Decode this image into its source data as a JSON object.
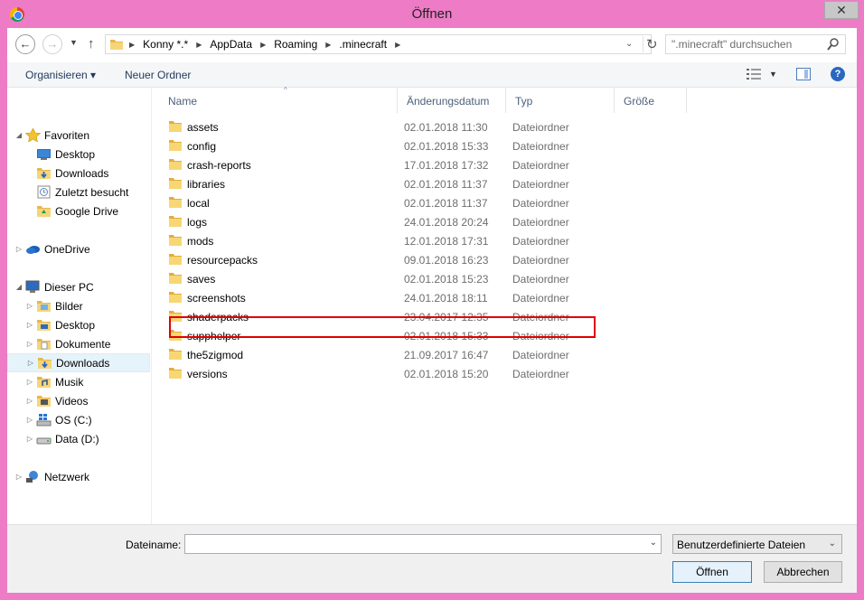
{
  "window": {
    "title": "Öffnen",
    "close_label": "✕"
  },
  "nav": {
    "breadcrumbs": [
      "Konny *.*",
      "AppData",
      "Roaming",
      ".minecraft"
    ],
    "search_placeholder": "\".minecraft\" durchsuchen"
  },
  "toolbar": {
    "organize_label": "Organisieren ▾",
    "new_folder_label": "Neuer Ordner"
  },
  "sidebar": {
    "items": [
      {
        "label": "Favoriten",
        "icon": "star-icon",
        "arrow": "◢"
      },
      {
        "label": "Desktop",
        "icon": "desktop-icon"
      },
      {
        "label": "Downloads",
        "icon": "downloads-folder-icon"
      },
      {
        "label": "Zuletzt besucht",
        "icon": "recent-places-icon"
      },
      {
        "label": "Google Drive",
        "icon": "google-drive-folder-icon"
      },
      {
        "label": "OneDrive",
        "icon": "onedrive-icon",
        "arrow": "▷"
      },
      {
        "label": "Dieser PC",
        "icon": "computer-icon",
        "arrow": "◢"
      },
      {
        "label": "Bilder",
        "icon": "pictures-folder-icon",
        "arrow": "▷"
      },
      {
        "label": "Desktop",
        "icon": "desktop-folder-icon",
        "arrow": "▷"
      },
      {
        "label": "Dokumente",
        "icon": "documents-folder-icon",
        "arrow": "▷"
      },
      {
        "label": "Downloads",
        "icon": "downloads-folder-icon",
        "arrow": "▷"
      },
      {
        "label": "Musik",
        "icon": "music-folder-icon",
        "arrow": "▷"
      },
      {
        "label": "Videos",
        "icon": "videos-folder-icon",
        "arrow": "▷"
      },
      {
        "label": "OS (C:)",
        "icon": "windows-drive-icon",
        "arrow": "▷"
      },
      {
        "label": "Data (D:)",
        "icon": "drive-icon",
        "arrow": "▷"
      },
      {
        "label": "Netzwerk",
        "icon": "network-icon",
        "arrow": "▷"
      }
    ]
  },
  "columns": {
    "name": "Name",
    "date": "Änderungsdatum",
    "type": "Typ",
    "size": "Größe"
  },
  "files": [
    {
      "name": "assets",
      "date": "02.01.2018 11:30",
      "type": "Dateiordner"
    },
    {
      "name": "config",
      "date": "02.01.2018 15:33",
      "type": "Dateiordner"
    },
    {
      "name": "crash-reports",
      "date": "17.01.2018 17:32",
      "type": "Dateiordner"
    },
    {
      "name": "libraries",
      "date": "02.01.2018 11:37",
      "type": "Dateiordner"
    },
    {
      "name": "local",
      "date": "02.01.2018 11:37",
      "type": "Dateiordner"
    },
    {
      "name": "logs",
      "date": "24.01.2018 20:24",
      "type": "Dateiordner"
    },
    {
      "name": "mods",
      "date": "12.01.2018 17:31",
      "type": "Dateiordner"
    },
    {
      "name": "resourcepacks",
      "date": "09.01.2018 16:23",
      "type": "Dateiordner"
    },
    {
      "name": "saves",
      "date": "02.01.2018 15:23",
      "type": "Dateiordner"
    },
    {
      "name": "screenshots",
      "date": "24.01.2018 18:11",
      "type": "Dateiordner"
    },
    {
      "name": "shaderpacks",
      "date": "23.04.2017 12:35",
      "type": "Dateiordner"
    },
    {
      "name": "supphelper",
      "date": "02.01.2018 15:33",
      "type": "Dateiordner"
    },
    {
      "name": "the5zigmod",
      "date": "21.09.2017 16:47",
      "type": "Dateiordner"
    },
    {
      "name": "versions",
      "date": "02.01.2018 15:20",
      "type": "Dateiordner"
    }
  ],
  "highlighted_file": "screenshots",
  "bottom": {
    "filename_label": "Dateiname:",
    "filename_value": "",
    "filter_value": "Benutzerdefinierte Dateien",
    "open_label": "Öffnen",
    "cancel_label": "Abbrechen"
  },
  "colors": {
    "frame": "#ee7bc6",
    "highlight": "#e00000",
    "selection": "#e5f3fb"
  }
}
